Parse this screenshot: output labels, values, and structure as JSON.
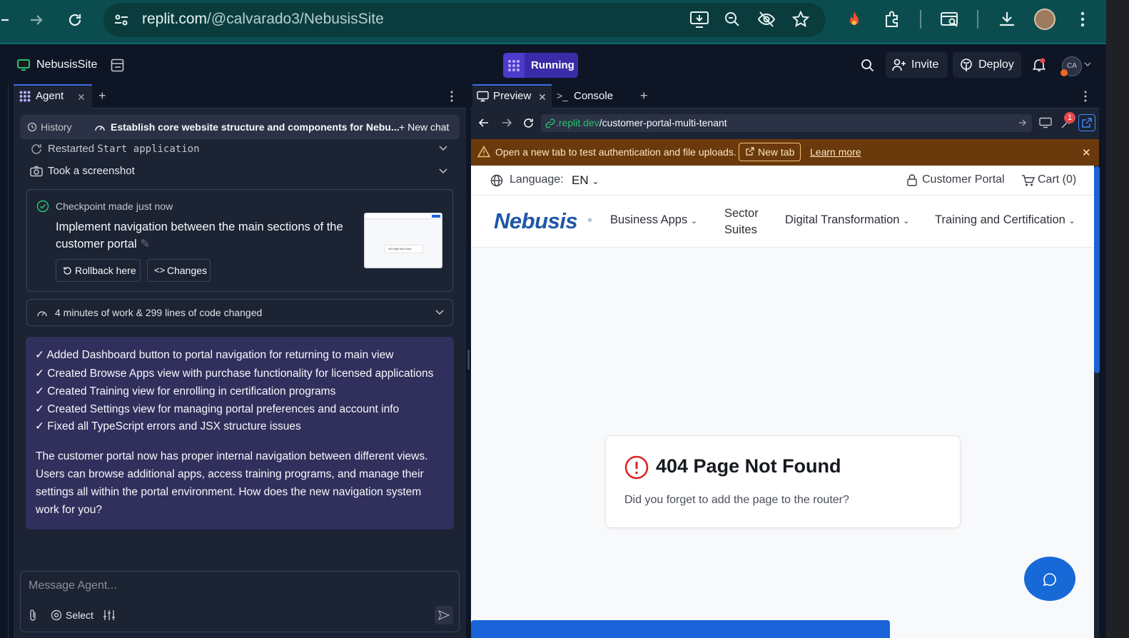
{
  "browser": {
    "url_host": "replit.com",
    "url_path": "/@calvarado3/NebusisSite"
  },
  "topbar": {
    "project_name": "NebusisSite",
    "run_status": "Running",
    "invite_label": "Invite",
    "deploy_label": "Deploy",
    "avatar_initials": "CA"
  },
  "agent": {
    "tab_label": "Agent",
    "history_label": "History",
    "chat_title": "Establish core website structure and components for Nebu...",
    "new_chat_label": "New chat",
    "step_restarted_prefix": "Restarted",
    "step_restarted_code": "Start application",
    "step_screenshot": "Took a screenshot",
    "checkpoint": {
      "status": "Checkpoint made just now",
      "description": "Implement navigation between the main sections of the customer portal",
      "rollback_label": "Rollback here",
      "changes_label": "Changes",
      "thumb_text": "404 Page Not Found"
    },
    "work_summary": "4 minutes of work & 299 lines of code changed",
    "summary_items": [
      "✓ Added Dashboard button to portal navigation for returning to main view",
      "✓ Created Browse Apps view with purchase functionality for licensed applications",
      "✓ Created Training view for enrolling in certification programs",
      "✓ Created Settings view for managing portal preferences and account info",
      "✓ Fixed all TypeScript errors and JSX structure issues"
    ],
    "summary_paragraph": "The customer portal now has proper internal navigation between different views. Users can browse additional apps, access training programs, and manage their settings all within the portal environment. How does the new navigation system work for you?",
    "message_placeholder": "Message Agent...",
    "select_label": "Select"
  },
  "preview": {
    "tab_preview": "Preview",
    "tab_console": "Console",
    "address_host": ".replit.dev",
    "address_path": "/customer-portal-multi-tenant",
    "badge_count": "1",
    "warning_text": "Open a new tab to test authentication and file uploads.",
    "newtab_label": "New tab",
    "learn_more_label": "Learn more"
  },
  "site": {
    "language_label": "Language:",
    "language_value": "EN",
    "customer_portal": "Customer Portal",
    "cart": "Cart (0)",
    "logo_text": "Nebusis",
    "nav": {
      "business_apps": "Business Apps",
      "sector_suites_line1": "Sector",
      "sector_suites_line2": "Suites",
      "digital_transformation": "Digital Transformation",
      "training": "Training and Certification"
    },
    "error_title": "404 Page Not Found",
    "error_subtitle": "Did you forget to add the page to the router?"
  },
  "colors": {
    "replit_bg": "#0e1525",
    "panel_bg": "#1c2333",
    "running_purple": "#3a2ca8",
    "summary_bg": "#31305c",
    "warning_bg": "#6b3a0c",
    "brand_blue": "#1a63d8",
    "error_red": "#dc2626"
  }
}
